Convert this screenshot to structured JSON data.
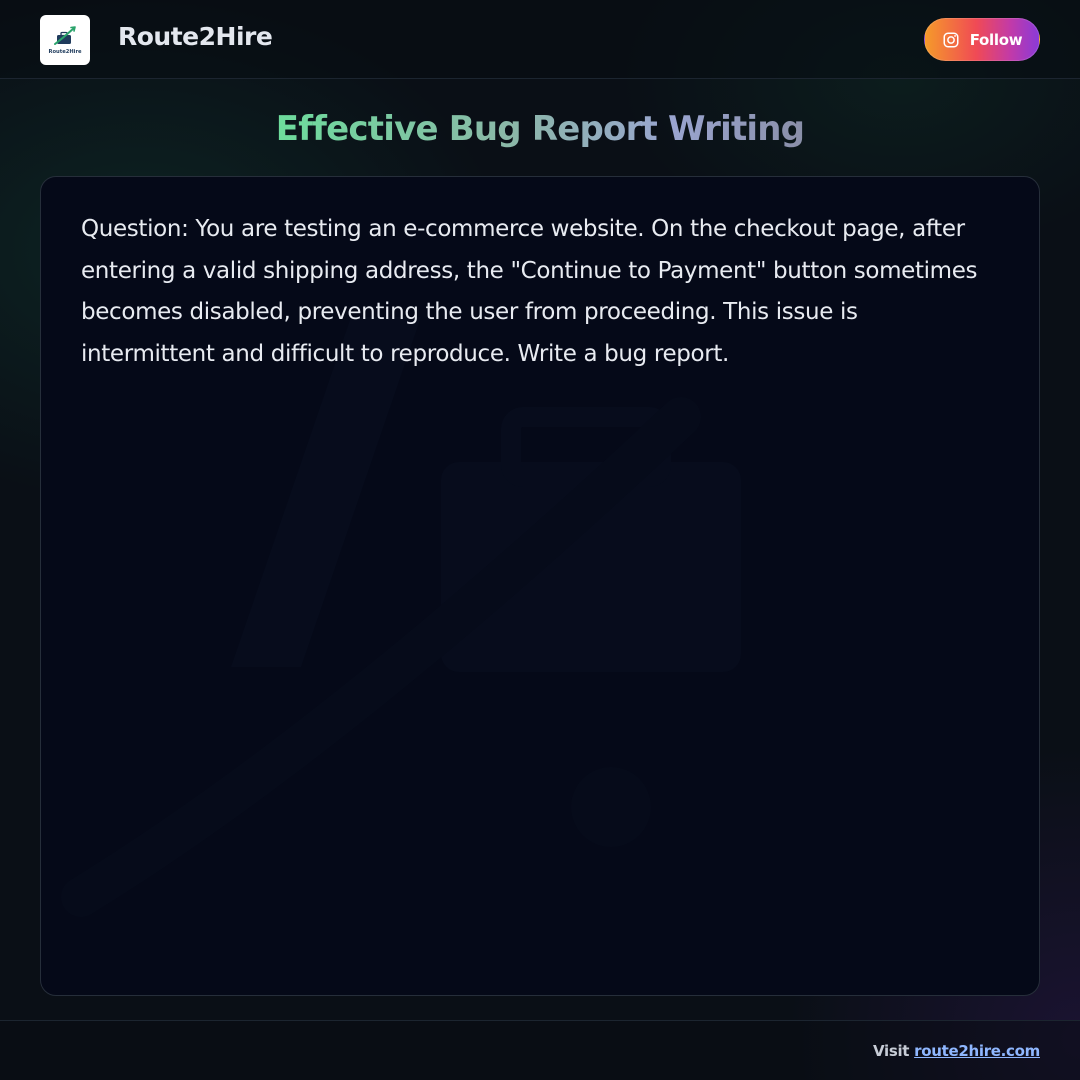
{
  "header": {
    "brand_name": "Route2Hire",
    "logo_text": "Route2Hire",
    "follow_label": "Follow",
    "follow_icon": "instagram-icon"
  },
  "main": {
    "title": "Effective Bug Report Writing",
    "question": "Question: You are testing an e-commerce website. On the checkout page, after entering a valid shipping address, the \"Continue to Payment\" button sometimes becomes disabled, preventing the user from proceeding. This issue is intermittent and difficult to reproduce. Write a bug report."
  },
  "footer": {
    "visit_label": "Visit",
    "link_text": "route2hire.com"
  },
  "colors": {
    "background": "#0a0f16",
    "card_background": "#050918",
    "title_gradient_start": "#6ddc9c",
    "title_gradient_end": "#8a8fa8",
    "follow_gradient_start": "#f59a2a",
    "follow_gradient_end": "#8a3ad8",
    "link": "#8fb7ff"
  }
}
